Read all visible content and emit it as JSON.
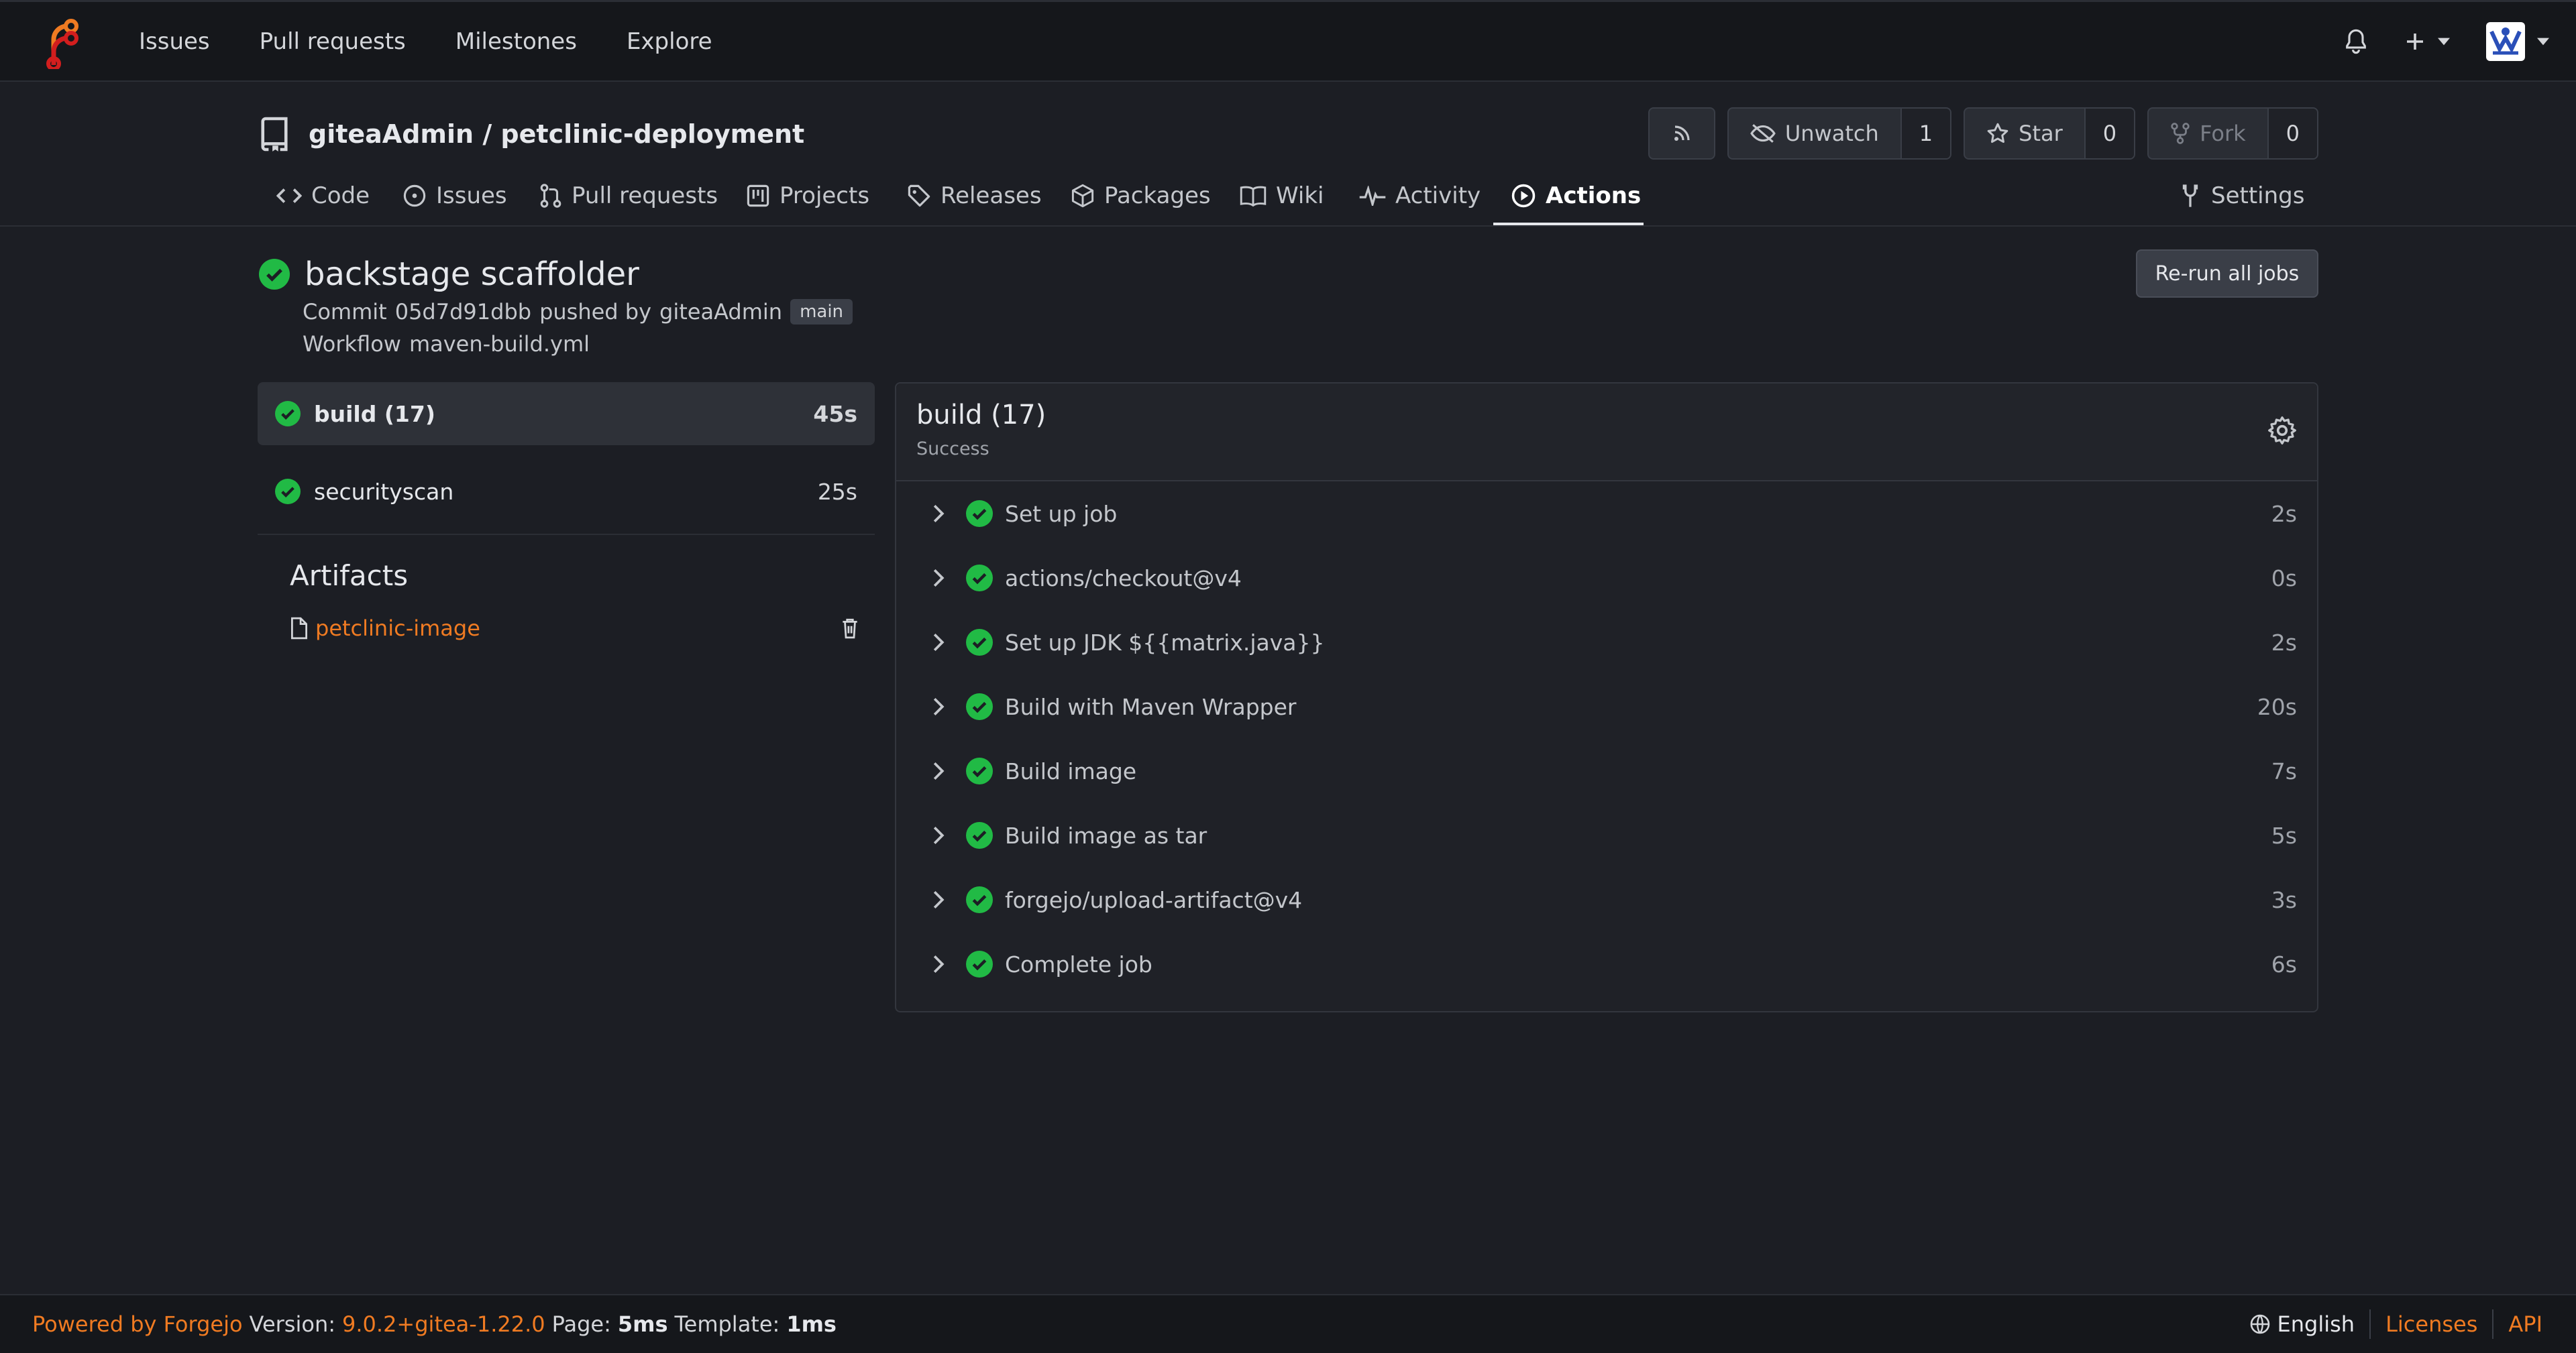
{
  "topbar": {
    "nav": [
      "Issues",
      "Pull requests",
      "Milestones",
      "Explore"
    ]
  },
  "repo": {
    "title": "giteaAdmin / petclinic-deployment",
    "unwatch_label": "Unwatch",
    "watch_count": "1",
    "star_label": "Star",
    "star_count": "0",
    "fork_label": "Fork",
    "fork_count": "0"
  },
  "tabs": [
    {
      "label": "Code",
      "icon": "code-icon"
    },
    {
      "label": "Issues",
      "icon": "issue-opened-icon"
    },
    {
      "label": "Pull requests",
      "icon": "git-pull-request-icon"
    },
    {
      "label": "Projects",
      "icon": "project-icon"
    },
    {
      "label": "Releases",
      "icon": "tag-icon"
    },
    {
      "label": "Packages",
      "icon": "package-icon"
    },
    {
      "label": "Wiki",
      "icon": "book-icon"
    },
    {
      "label": "Activity",
      "icon": "pulse-icon"
    },
    {
      "label": "Actions",
      "icon": "play-icon",
      "active": true
    },
    {
      "label": "Settings",
      "icon": "tools-icon"
    }
  ],
  "run": {
    "title": "backstage scaffolder",
    "commit_label": "Commit",
    "commit_sha": "05d7d91dbb",
    "pushed_by": "pushed by",
    "author": "giteaAdmin",
    "branch": "main",
    "workflow_label": "Workflow",
    "workflow_file": "maven-build.yml",
    "rerun_label": "Re-run all jobs"
  },
  "jobs": [
    {
      "name": "build (17)",
      "duration": "45s",
      "active": true
    },
    {
      "name": "securityscan",
      "duration": "25s"
    }
  ],
  "artifacts": {
    "title": "Artifacts",
    "items": [
      {
        "name": "petclinic-image"
      }
    ]
  },
  "job_panel": {
    "title": "build (17)",
    "status": "Success",
    "steps": [
      {
        "name": "Set up job",
        "duration": "2s"
      },
      {
        "name": "actions/checkout@v4",
        "duration": "0s"
      },
      {
        "name": "Set up JDK ${{matrix.java}}",
        "duration": "2s"
      },
      {
        "name": "Build with Maven Wrapper",
        "duration": "20s"
      },
      {
        "name": "Build image",
        "duration": "7s"
      },
      {
        "name": "Build image as tar",
        "duration": "5s"
      },
      {
        "name": "forgejo/upload-artifact@v4",
        "duration": "3s"
      },
      {
        "name": "Complete job",
        "duration": "6s"
      }
    ]
  },
  "footer": {
    "powered_by": "Powered by Forgejo",
    "version_label": "Version:",
    "version": "9.0.2+gitea-1.22.0",
    "page_label": "Page:",
    "page_time": "5ms",
    "template_label": "Template:",
    "template_time": "1ms",
    "language": "English",
    "licenses": "Licenses",
    "api": "API"
  },
  "colors": {
    "background": "#1c1e24",
    "success": "#21ba45",
    "accent": "#f07b22"
  }
}
